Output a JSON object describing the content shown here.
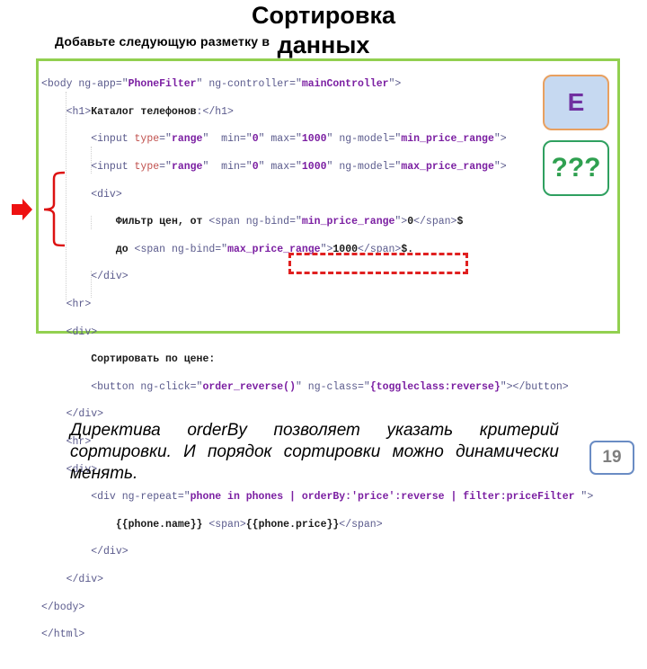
{
  "slide": {
    "title_line1": "Сортировка",
    "title_line2": "данных",
    "subtitle": "Добавьте  следующую разметку в",
    "badge_e": "E",
    "badge_question": "???",
    "description": "Директива orderBy позволяет указать критерий сортировки. И порядок сортировки можно динамически менять.",
    "page_number": "19"
  },
  "code": {
    "l1": {
      "a": "<body ng-app=\"",
      "b": "PhoneFilter",
      "c": "\" ng-controller=\"",
      "d": "mainController",
      "e": "\">"
    },
    "l2": {
      "a": "<h1>",
      "b": "Каталог телефонов",
      "c": ":</h1>"
    },
    "l3": {
      "a": "<input ",
      "b": "type",
      "c": "=\"",
      "d": "range",
      "e": "\"  min=\"",
      "f": "0",
      "g": "\" max=\"",
      "h": "1000",
      "i": "\" ng-model=\"",
      "j": "min_price_range",
      "k": "\">"
    },
    "l4": {
      "a": "<input ",
      "b": "type",
      "c": "=\"",
      "d": "range",
      "e": "\"  min=\"",
      "f": "0",
      "g": "\" max=\"",
      "h": "1000",
      "i": "\" ng-model=\"",
      "j": "max_price_range",
      "k": "\">"
    },
    "l5": {
      "a": "<div>"
    },
    "l6": {
      "a": "Фильтр цен, от",
      "b": " <span ng-bind=\"",
      "c": "min_price_range",
      "d": "\">",
      "e": "0",
      "f": "</span>",
      "g": "$"
    },
    "l7": {
      "a": "до",
      "b": " <span ng-bind=\"",
      "c": "max_price_range",
      "d": "\">",
      "e": "1000",
      "f": "</span>",
      "g": "$."
    },
    "l8": {
      "a": "</div>"
    },
    "l9": {
      "a": "<hr>"
    },
    "l10": {
      "a": "<div>"
    },
    "l11": {
      "a": "Сортировать по цене:"
    },
    "l12": {
      "a": "<button ng-click=\"",
      "b": "order_reverse()",
      "c": "\" ng-class=\"",
      "d": "{toggleclass:reverse}",
      "e": "\"></button>"
    },
    "l13": {
      "a": "</div>"
    },
    "l14": {
      "a": "<hr>"
    },
    "l15": {
      "a": "<div>"
    },
    "l16": {
      "a": "<div ng-repeat=\"",
      "b": "phone in phones | orderBy:'price':reverse | filter:priceFilter ",
      "c": "\">"
    },
    "l17": {
      "a": "{{phone.name}}",
      "b": " <span>",
      "c": "{{phone.price}}",
      "d": "</span>"
    },
    "l18": {
      "a": "</div>"
    },
    "l19": {
      "a": "</div>"
    },
    "l20": {
      "a": "</body>"
    },
    "l21": {
      "a": "</html>"
    }
  },
  "colors": {
    "code_border": "#92d050",
    "highlight_red": "#e02020",
    "badge_e_bg": "#c6d9f1",
    "badge_e_border": "#e8a060",
    "badge_e_text": "#7030a0",
    "badge_q_border": "#2fa060",
    "badge_q_text": "#2fa050",
    "page_num_border": "#6a8cc4"
  }
}
